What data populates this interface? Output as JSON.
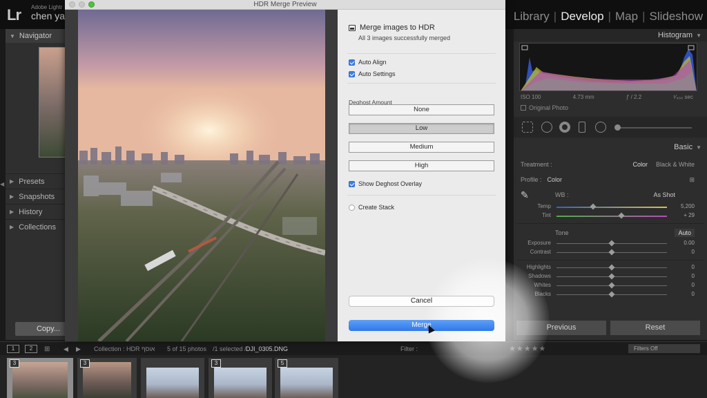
{
  "lightroom": {
    "logo": "Lr",
    "brand_small": "Adobe Lightr",
    "user_name": "chen yak",
    "modules": [
      "Library",
      "Develop",
      "Map",
      "Slideshow"
    ],
    "active_module": "Develop",
    "module_separator": "|"
  },
  "left_panel": {
    "navigator_label": "Navigator",
    "items": [
      "Presets",
      "Snapshots",
      "History",
      "Collections"
    ],
    "copy_button": "Copy..."
  },
  "right_panel": {
    "histogram_label": "Histogram",
    "histogram_info": {
      "iso": "ISO 100",
      "focal": "4.73 mm",
      "aperture": "ƒ / 2.2",
      "shutter": "¹⁄₄₀₀ sec"
    },
    "original_photo_label": "Original Photo",
    "basic_label": "Basic",
    "treatment_label": "Treatment :",
    "treatment_color": "Color",
    "treatment_bw": "Black & White",
    "profile_label": "Profile :",
    "profile_value": "Color",
    "wb_label": "WB :",
    "wb_value": "As Shot",
    "temp": {
      "label": "Temp",
      "value": "5,200",
      "level": 0.33
    },
    "tint": {
      "label": "Tint",
      "value": "+ 29",
      "level": 0.59
    },
    "tone_label": "Tone",
    "auto_label": "Auto",
    "tone_sliders": [
      {
        "label": "Exposure",
        "value": "0.00"
      },
      {
        "label": "Contrast",
        "value": "0"
      }
    ],
    "presence_sliders": [
      {
        "label": "Highlights",
        "value": "0"
      },
      {
        "label": "Shadows",
        "value": "0"
      },
      {
        "label": "Whites",
        "value": "0"
      },
      {
        "label": "Blacks",
        "value": "0"
      }
    ],
    "previous_button": "Previous",
    "reset_button": "Reset"
  },
  "filmstrip_bar": {
    "page1": "1",
    "page2": "2",
    "collection": "Collection : HDR אוסף",
    "count": "5 of 15 photos",
    "selected": "/1 selected /",
    "filename": "DJI_0305.DNG",
    "filter_label": "Filter :",
    "filters_off": "Filters Off",
    "stars": "★★★★★"
  },
  "filmstrip": {
    "badges": [
      "3",
      "3",
      "3",
      "5"
    ]
  },
  "dialog": {
    "title": "HDR Merge Preview",
    "heading": "Merge images to HDR",
    "status": "All 3 images successfully merged",
    "auto_align": {
      "label": "Auto Align",
      "checked": true
    },
    "auto_settings": {
      "label": "Auto Settings",
      "checked": true
    },
    "deghost_label": "Deghost Amount",
    "deghost_options": [
      "None",
      "Low",
      "Medium",
      "High"
    ],
    "deghost_selected": "Low",
    "show_overlay": {
      "label": "Show Deghost Overlay",
      "checked": true
    },
    "create_stack": {
      "label": "Create Stack",
      "checked": false
    },
    "cancel_button": "Cancel",
    "merge_button": "Merge"
  },
  "colors": {
    "accent_blue": "#3b7fe4",
    "merge_blue": "#2f78ea"
  }
}
